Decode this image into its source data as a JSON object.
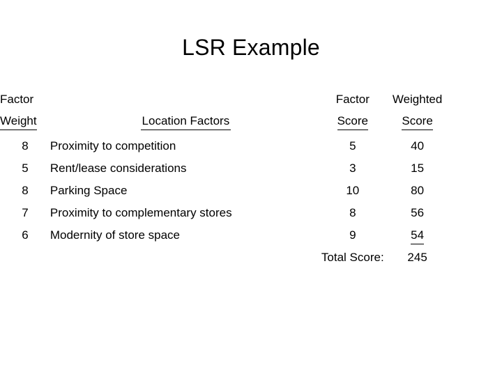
{
  "slide": {
    "title": "LSR Example",
    "background_color": "#ffffff",
    "text_color": "#000000"
  },
  "table": {
    "headers": {
      "weight_line1": "Factor",
      "weight_line2": "Weight",
      "factors_label": "Location Factors",
      "score_line1": "Factor",
      "score_line2": "Score",
      "weighted_line1": "Weighted",
      "weighted_line2": "Score"
    },
    "rows": [
      {
        "weight": "8",
        "factor": "Proximity to competition",
        "score": "5",
        "weighted": "40"
      },
      {
        "weight": "5",
        "factor": "Rent/lease considerations",
        "score": "3",
        "weighted": "15"
      },
      {
        "weight": "8",
        "factor": "Parking Space",
        "score": "10",
        "weighted": "80"
      },
      {
        "weight": "7",
        "factor": "Proximity to complementary stores",
        "score": "8",
        "weighted": "56"
      },
      {
        "weight": "6",
        "factor": "Modernity of store space",
        "score": "9",
        "weighted": "54"
      }
    ],
    "total": {
      "label": "Total Score:",
      "value": "245"
    }
  }
}
